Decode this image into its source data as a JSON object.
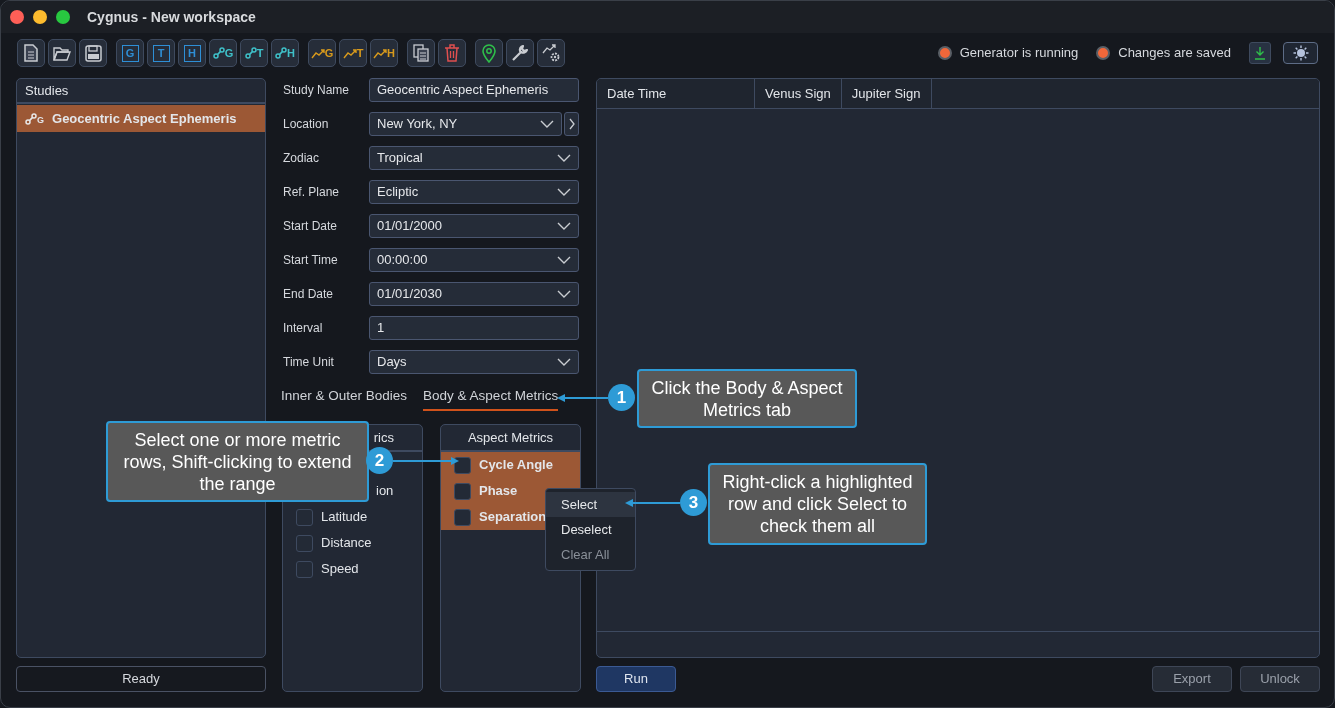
{
  "window": {
    "title": "Cygnus - New workspace"
  },
  "toolbar": [
    [
      {
        "kind": "document"
      },
      {
        "kind": "folder"
      },
      {
        "kind": "save"
      }
    ],
    [
      {
        "kind": "boxed",
        "letter": "G"
      },
      {
        "kind": "boxed",
        "letter": "T"
      },
      {
        "kind": "boxed",
        "letter": "H"
      },
      {
        "kind": "nodes",
        "letter": "G"
      },
      {
        "kind": "nodes",
        "letter": "T"
      },
      {
        "kind": "nodes",
        "letter": "H"
      }
    ],
    [
      {
        "kind": "trend",
        "letter": "G"
      },
      {
        "kind": "trend",
        "letter": "T"
      },
      {
        "kind": "trend",
        "letter": "H"
      }
    ],
    [
      {
        "kind": "copy"
      },
      {
        "kind": "trash"
      }
    ],
    [
      {
        "kind": "pin"
      },
      {
        "kind": "wrench"
      },
      {
        "kind": "trendgear"
      }
    ]
  ],
  "status": [
    {
      "label": "Generator is running",
      "color": "#f0673a"
    },
    {
      "label": "Changes are saved",
      "color": "#f0673a"
    }
  ],
  "studies": {
    "title": "Studies",
    "items": [
      {
        "label": "Geocentric Aspect Ephemeris",
        "icon_letter": "G",
        "selected": true
      }
    ]
  },
  "form": [
    {
      "label": "Study Name",
      "kind": "text",
      "value": "Geocentric Aspect Ephemeris"
    },
    {
      "label": "Location",
      "kind": "select_next",
      "value": "New York, NY"
    },
    {
      "label": "Zodiac",
      "kind": "select",
      "value": "Tropical"
    },
    {
      "label": "Ref. Plane",
      "kind": "select",
      "value": "Ecliptic"
    },
    {
      "label": "Start Date",
      "kind": "select",
      "value": "01/01/2000"
    },
    {
      "label": "Start Time",
      "kind": "select",
      "value": "00:00:00"
    },
    {
      "label": "End Date",
      "kind": "select",
      "value": "01/01/2030"
    },
    {
      "label": "Interval",
      "kind": "text",
      "value": "1"
    },
    {
      "label": "Time Unit",
      "kind": "select",
      "value": "Days"
    }
  ],
  "tabs": [
    {
      "label": "Inner & Outer Bodies",
      "selected": false
    },
    {
      "label": "Body & Aspect Metrics",
      "selected": true
    }
  ],
  "body_metrics": {
    "title": "rics",
    "items": [
      {
        "label": "ion"
      },
      {
        "label": "Latitude",
        "checked": false,
        "selected": false
      },
      {
        "label": "Distance",
        "checked": false,
        "selected": false
      },
      {
        "label": "Speed",
        "checked": false,
        "selected": false
      }
    ]
  },
  "aspect_metrics": {
    "title": "Aspect Metrics",
    "items": [
      {
        "label": "Cycle Angle",
        "checked": false,
        "selected": true
      },
      {
        "label": "Phase",
        "checked": false,
        "selected": true
      },
      {
        "label": "Separation",
        "checked": false,
        "selected": true
      }
    ]
  },
  "context_menu": [
    {
      "label": "Select",
      "selected": true,
      "disabled": false
    },
    {
      "label": "Deselect",
      "selected": false,
      "disabled": false
    },
    {
      "label": "Clear All",
      "selected": false,
      "disabled": true
    }
  ],
  "table": {
    "columns": [
      "Date Time",
      "Venus Sign",
      "Jupiter Sign"
    ]
  },
  "status_bar": "Ready",
  "buttons": [
    {
      "label": "Run",
      "kind": "primary"
    },
    {
      "label": "Export",
      "kind": "secondary"
    },
    {
      "label": "Unlock",
      "kind": "secondary"
    }
  ],
  "callouts": [
    {
      "number": "1",
      "text": "Click the Body & Aspect Metrics tab"
    },
    {
      "number": "2",
      "text": "Select one or more metric rows, Shift-clicking to extend the range"
    },
    {
      "number": "3",
      "text": "Right-click a highlighted row and click Select to check them all"
    }
  ]
}
